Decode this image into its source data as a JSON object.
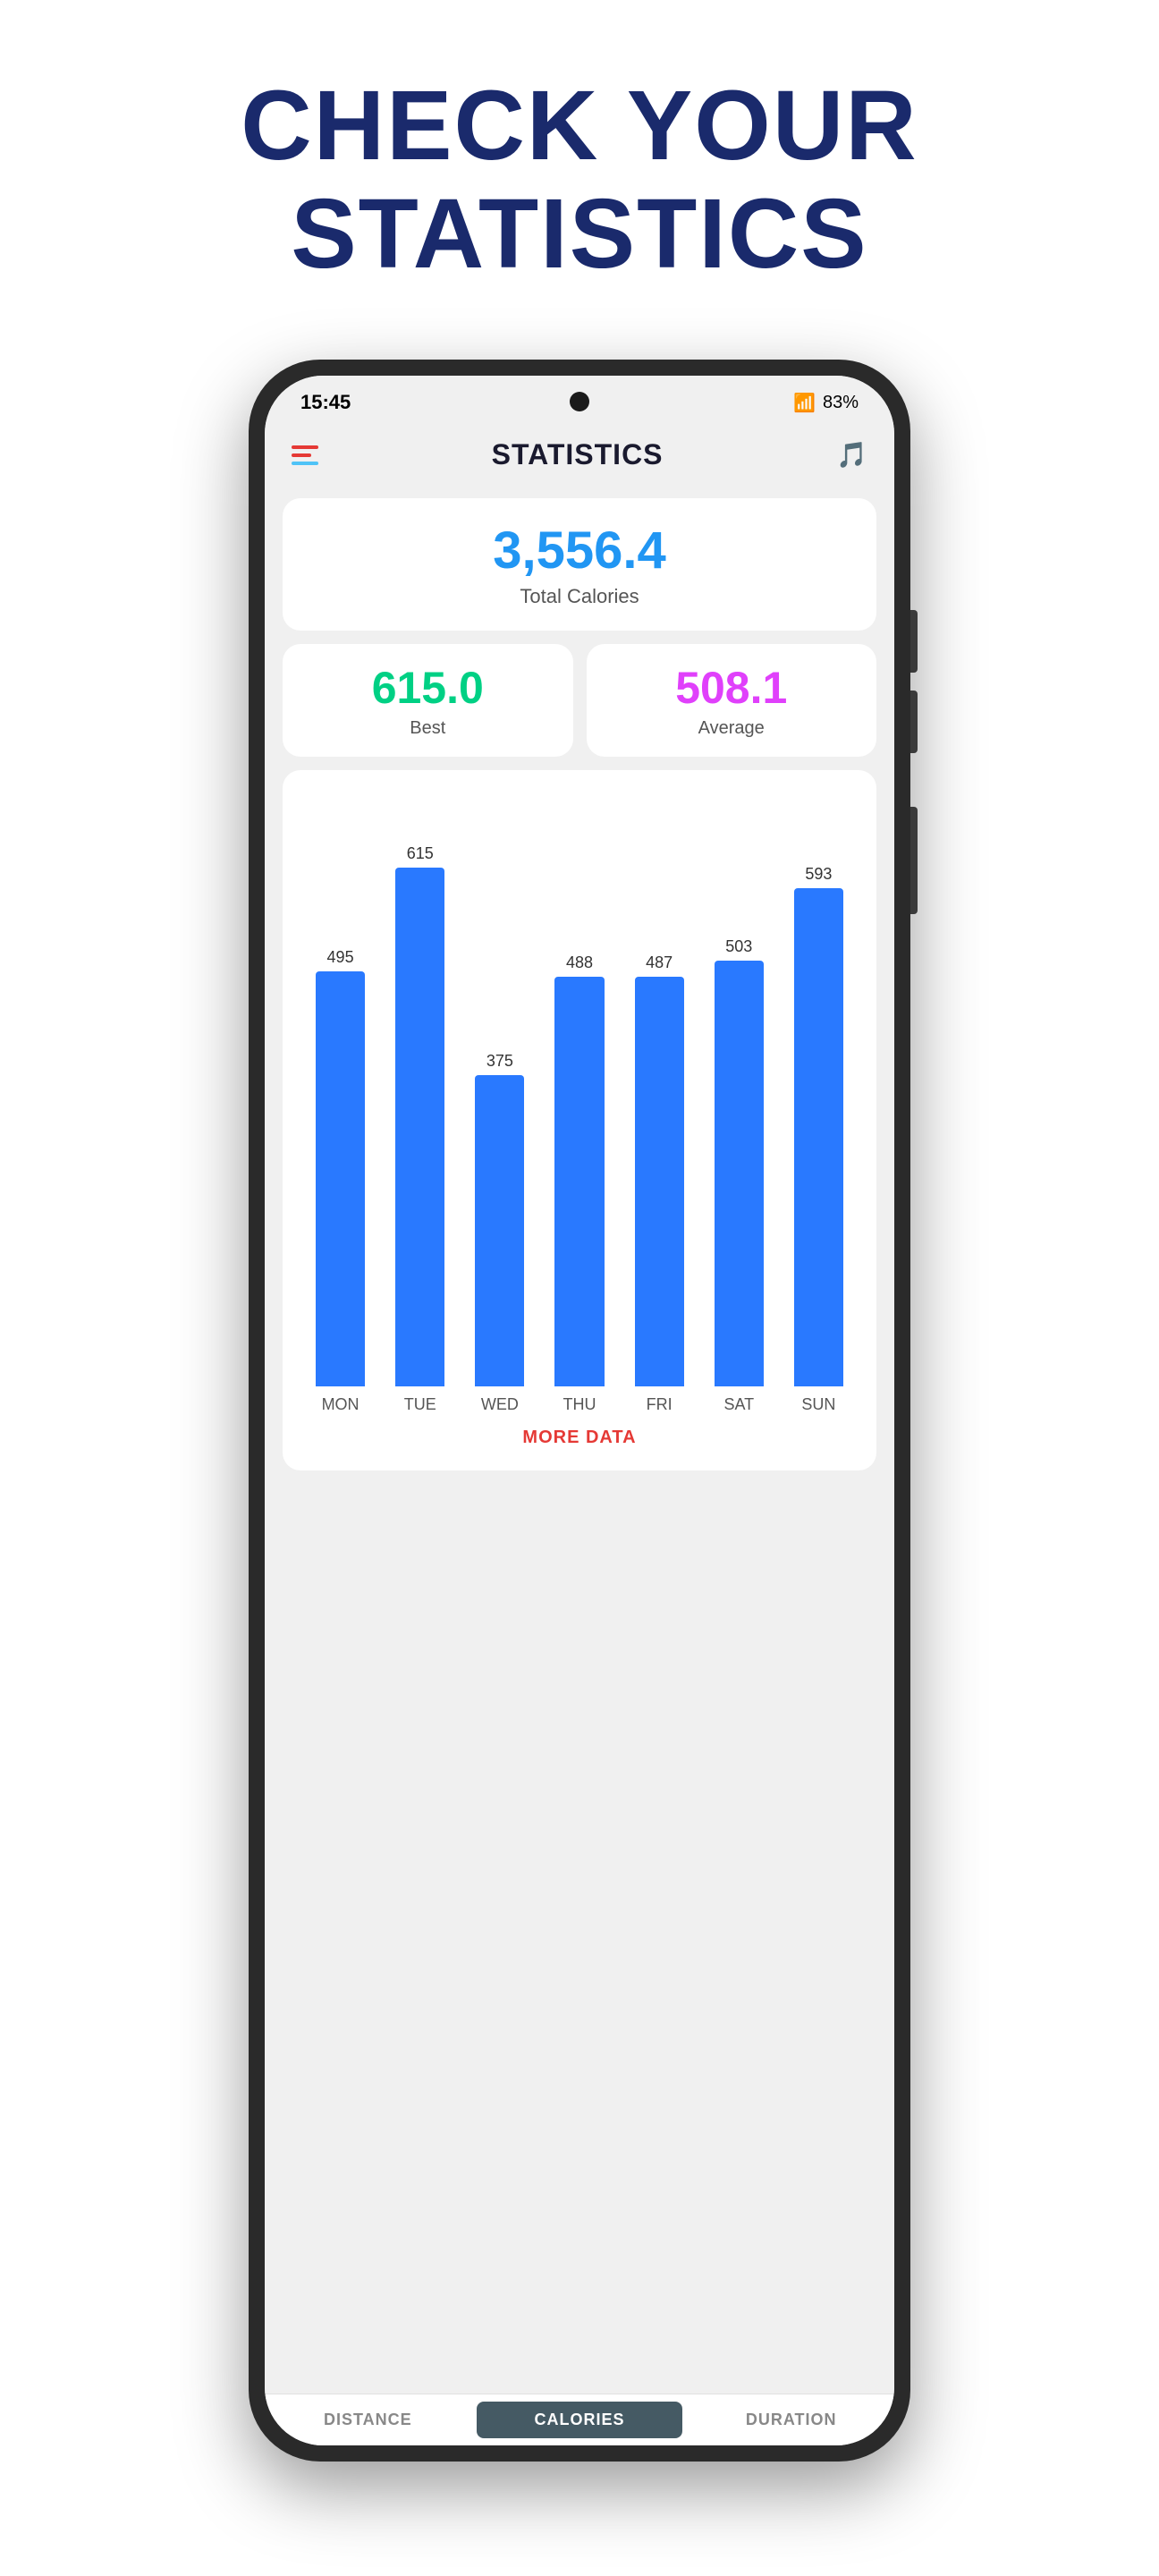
{
  "hero": {
    "title_line1": "CHECK YOUR",
    "title_line2": "STATISTICS"
  },
  "status_bar": {
    "time": "15:45",
    "battery": "83%",
    "signal": "VoLTE"
  },
  "header": {
    "title": "STATISTICS"
  },
  "total_calories": {
    "value": "3,556.4",
    "label": "Total Calories"
  },
  "best": {
    "value": "615.0",
    "label": "Best"
  },
  "average": {
    "value": "508.1",
    "label": "Average"
  },
  "chart": {
    "bars": [
      {
        "day": "MON",
        "value": 495,
        "height_pct": 80
      },
      {
        "day": "TUE",
        "value": 615,
        "height_pct": 100
      },
      {
        "day": "WED",
        "value": 375,
        "height_pct": 60
      },
      {
        "day": "THU",
        "value": 488,
        "height_pct": 79
      },
      {
        "day": "FRI",
        "value": 487,
        "height_pct": 79
      },
      {
        "day": "SAT",
        "value": 503,
        "height_pct": 82
      },
      {
        "day": "SUN",
        "value": 593,
        "height_pct": 96
      }
    ]
  },
  "more_data_label": "MORE DATA",
  "tabs": [
    {
      "id": "distance",
      "label": "DISTANCE",
      "active": false
    },
    {
      "id": "calories",
      "label": "CALORIES",
      "active": true
    },
    {
      "id": "duration",
      "label": "DURATION",
      "active": false
    }
  ]
}
